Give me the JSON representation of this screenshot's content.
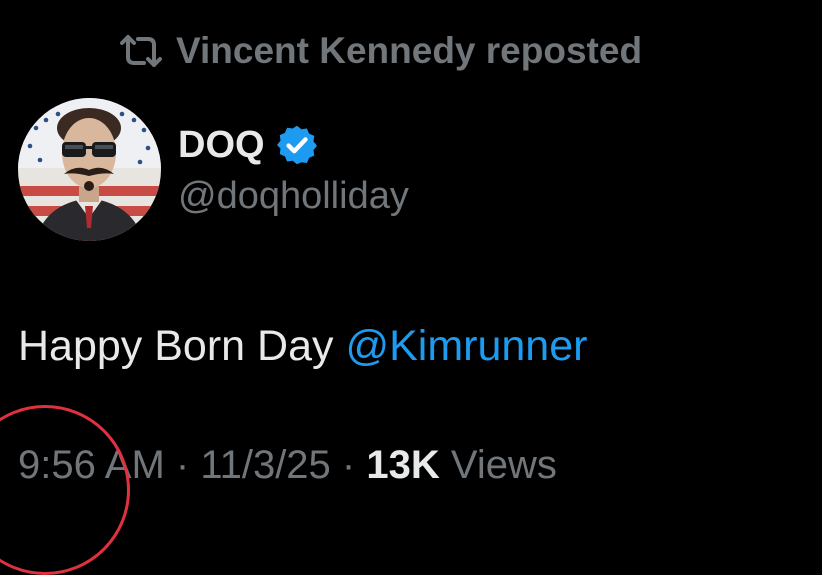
{
  "repost": {
    "text": "Vincent Kennedy reposted",
    "icon": "repost-icon"
  },
  "author": {
    "display_name": "DOQ",
    "handle": "@doqholliday",
    "verified": true,
    "verified_icon": "verified-badge-icon",
    "avatar_icon": "avatar-portrait"
  },
  "tweet": {
    "text_prefix": "Happy Born Day ",
    "mention": "@Kimrunner"
  },
  "meta": {
    "time": "9:56 AM",
    "separator": " · ",
    "date": "11/3/25",
    "views_count": "13K",
    "views_label": " Views"
  },
  "colors": {
    "background": "#000000",
    "primary_text": "#e7e9ea",
    "secondary_text": "#71767b",
    "link": "#1d9bf0",
    "annotation_circle": "#e0313e"
  }
}
